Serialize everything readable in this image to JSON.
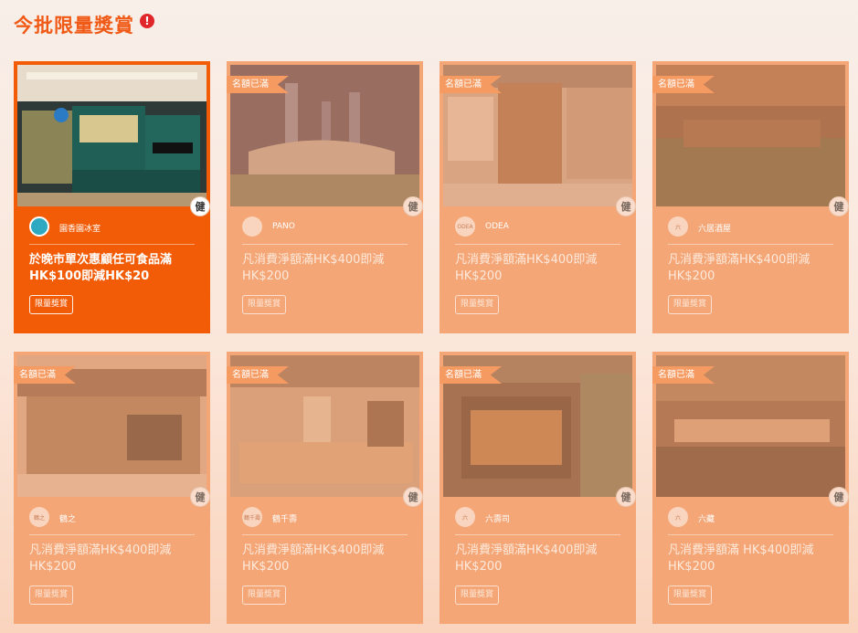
{
  "header": {
    "title": "今批限量獎賞",
    "alert_icon": "!"
  },
  "ribbon_label": "名額已滿",
  "tag_label": "限量獎賞",
  "brand_icon_glyph": "健",
  "cards": [
    {
      "name": "園香園冰室",
      "logo": "",
      "offer": "於晚市單次惠顧任可食品滿HK$100即減HK$20",
      "sold_out": false,
      "photo": "cafe"
    },
    {
      "name": "PANO",
      "logo": "",
      "offer": "凡消費淨額滿HK$400即減HK$200",
      "sold_out": true,
      "photo": "city"
    },
    {
      "name": "ODEA",
      "logo": "ODEA",
      "offer": "凡消費淨額滿HK$400即減HK$200",
      "sold_out": true,
      "photo": "odea"
    },
    {
      "name": "六居酒屋",
      "logo": "六",
      "offer": "凡消費淨額滿HK$400即減HK$200",
      "sold_out": true,
      "photo": "restaurant"
    },
    {
      "name": "鶴之",
      "logo": "鶴之",
      "offer": "凡消費淨額滿HK$400即減HK$200",
      "sold_out": true,
      "photo": "japan"
    },
    {
      "name": "鶴千壽",
      "logo": "鶴千壽",
      "offer": "凡消費淨額滿HK$400即減HK$200",
      "sold_out": true,
      "photo": "wood"
    },
    {
      "name": "六壽司",
      "logo": "六",
      "offer": "凡消費淨額滿HK$400即減HK$200",
      "sold_out": true,
      "photo": "street"
    },
    {
      "name": "六藏",
      "logo": "六",
      "offer": "凡消費淨額滿 HK$400即減HK$200",
      "sold_out": true,
      "photo": "bar"
    }
  ],
  "colors": {
    "accent": "#f25c07",
    "card": "#f4a676",
    "title": "#f05a16"
  }
}
